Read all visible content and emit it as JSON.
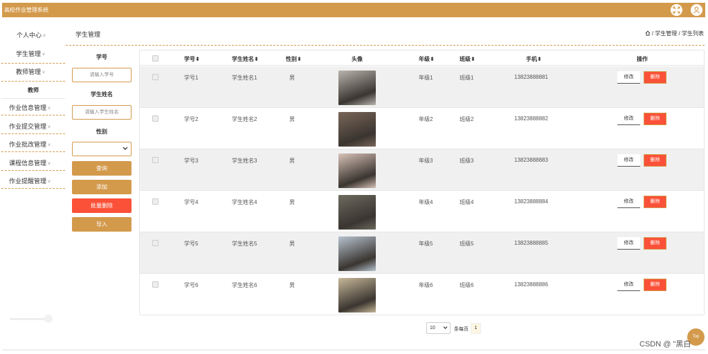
{
  "app": {
    "title": "高校作业管理系统"
  },
  "sidebar": {
    "items": [
      {
        "label": "个人中心"
      },
      {
        "label": "学生管理"
      },
      {
        "label": "教师管理"
      },
      {
        "label": "教师"
      },
      {
        "label": "作业信息管理"
      },
      {
        "label": "作业提交管理"
      },
      {
        "label": "作业批改管理"
      },
      {
        "label": "课程信息管理"
      },
      {
        "label": "作业提醒管理"
      }
    ],
    "caret": "˅"
  },
  "header": {
    "page_title": "学生管理",
    "breadcrumb": [
      "学生管理",
      "学生列表"
    ],
    "breadcrumb_sep": "/"
  },
  "search": {
    "student_no_label": "学号",
    "student_no_placeholder": "请输入学号",
    "student_name_label": "学生姓名",
    "student_name_placeholder": "请输入学生姓名",
    "gender_label": "性别",
    "gender_value": "",
    "query_label": "查询",
    "add_label": "添加",
    "batch_delete_label": "批量删除",
    "import_label": "导入"
  },
  "table": {
    "columns": [
      "学号",
      "学生姓名",
      "性别",
      "头像",
      "年级",
      "班级",
      "手机",
      "操作"
    ],
    "sort_glyph": "⬍",
    "edit_label": "修改",
    "delete_label": "删除",
    "rows": [
      {
        "student_no": "学号1",
        "name": "学生姓名1",
        "gender": "男",
        "grade": "年级1",
        "class": "班级1",
        "phone": "13823888881",
        "avatar_color": "#b9b4ad"
      },
      {
        "student_no": "学号2",
        "name": "学生姓名2",
        "gender": "男",
        "grade": "年级2",
        "class": "班级2",
        "phone": "13823888882",
        "avatar_color": "#7a6658"
      },
      {
        "student_no": "学号3",
        "name": "学生姓名3",
        "gender": "男",
        "grade": "年级3",
        "class": "班级3",
        "phone": "13823888883",
        "avatar_color": "#d8c2b7"
      },
      {
        "student_no": "学号4",
        "name": "学生姓名4",
        "gender": "男",
        "grade": "年级4",
        "class": "班级4",
        "phone": "13823888884",
        "avatar_color": "#6d6a60"
      },
      {
        "student_no": "学号5",
        "name": "学生姓名5",
        "gender": "男",
        "grade": "年级5",
        "class": "班级5",
        "phone": "13823888885",
        "avatar_color": "#b7c3d0"
      },
      {
        "student_no": "学号6",
        "name": "学生姓名6",
        "gender": "男",
        "grade": "年级6",
        "class": "班级6",
        "phone": "13823888886",
        "avatar_color": "#c8b89a"
      }
    ]
  },
  "pagination": {
    "page_size": "10",
    "per_page_label": "条每页",
    "current_page": "1"
  },
  "back_to_top": "Top",
  "watermark": "CSDN @ \"黑白",
  "colors": {
    "accent": "#d39a4c",
    "danger": "#fb5138"
  }
}
